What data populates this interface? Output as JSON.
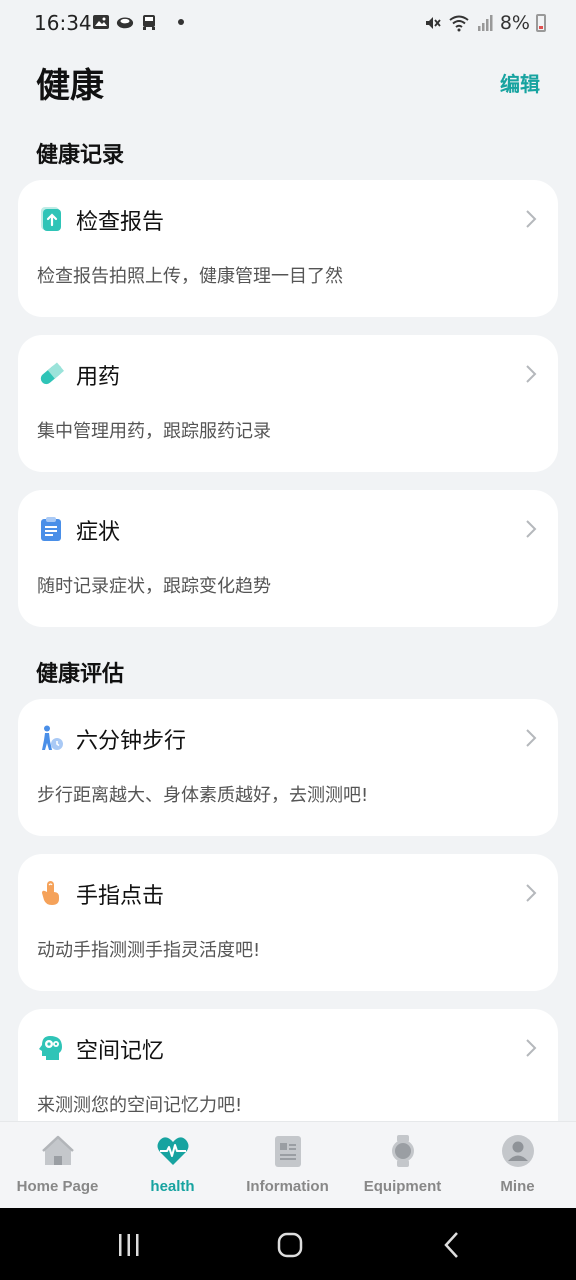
{
  "status_bar": {
    "time": "16:34",
    "battery": "8%"
  },
  "header": {
    "title": "健康",
    "edit_label": "编辑"
  },
  "sections": [
    {
      "title": "健康记录"
    },
    {
      "title": "健康评估"
    }
  ],
  "cards": [
    {
      "title": "检查报告",
      "desc": "检查报告拍照上传，健康管理一目了然",
      "icon": "report-upload-icon"
    },
    {
      "title": "用药",
      "desc": "集中管理用药，跟踪服药记录",
      "icon": "pill-icon"
    },
    {
      "title": "症状",
      "desc": "随时记录症状，跟踪变化趋势",
      "icon": "clipboard-icon"
    },
    {
      "title": "六分钟步行",
      "desc": "步行距离越大、身体素质越好，去测测吧!",
      "icon": "walking-person-icon"
    },
    {
      "title": "手指点击",
      "desc": "动动手指测测手指灵活度吧!",
      "icon": "finger-tap-icon"
    },
    {
      "title": "空间记忆",
      "desc": "来测测您的空间记忆力吧!",
      "icon": "brain-head-icon"
    }
  ],
  "bottom_nav": [
    {
      "label": "Home Page",
      "icon": "home-icon"
    },
    {
      "label": "health",
      "icon": "heart-pulse-icon",
      "active": true
    },
    {
      "label": "Information",
      "icon": "info-card-icon"
    },
    {
      "label": "Equipment",
      "icon": "watch-icon"
    },
    {
      "label": "Mine",
      "icon": "user-icon"
    }
  ],
  "colors": {
    "accent": "#17a3a0",
    "background": "#f1f3f5",
    "card": "#ffffff"
  }
}
